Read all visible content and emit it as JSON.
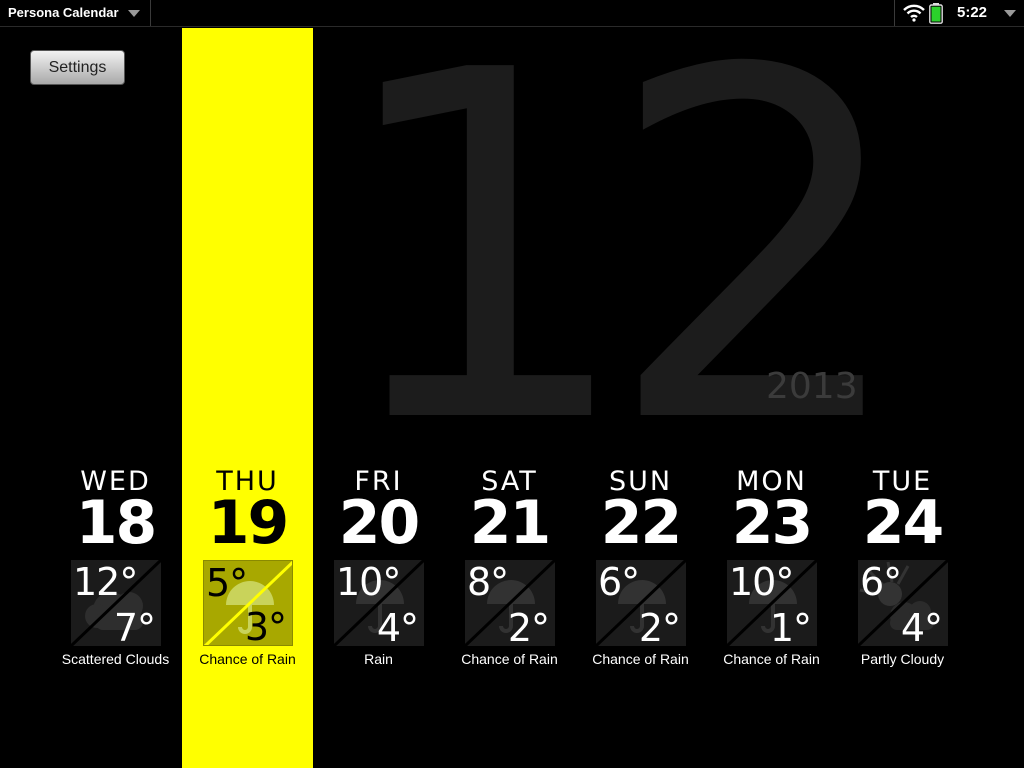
{
  "statusbar": {
    "app_title": "Persona Calendar",
    "time": "5:22",
    "battery_color": "#2bd12b"
  },
  "settings": {
    "label": "Settings"
  },
  "calendar": {
    "month": "12",
    "year": "2013",
    "highlight_color": "#ffff00"
  },
  "forecast": [
    {
      "dow": "WED",
      "day": "18",
      "high": "12°",
      "low": "7°",
      "condition": "Scattered Clouds",
      "icon": "cloud-icon",
      "selected": false
    },
    {
      "dow": "THU",
      "day": "19",
      "high": "5°",
      "low": "3°",
      "condition": "Chance of Rain",
      "icon": "umbrella-icon",
      "selected": true
    },
    {
      "dow": "FRI",
      "day": "20",
      "high": "10°",
      "low": "4°",
      "condition": "Rain",
      "icon": "umbrella-icon",
      "selected": false
    },
    {
      "dow": "SAT",
      "day": "21",
      "high": "8°",
      "low": "2°",
      "condition": "Chance of Rain",
      "icon": "umbrella-icon",
      "selected": false
    },
    {
      "dow": "SUN",
      "day": "22",
      "high": "6°",
      "low": "2°",
      "condition": "Chance of Rain",
      "icon": "umbrella-icon",
      "selected": false
    },
    {
      "dow": "MON",
      "day": "23",
      "high": "10°",
      "low": "1°",
      "condition": "Chance of Rain",
      "icon": "umbrella-icon",
      "selected": false
    },
    {
      "dow": "TUE",
      "day": "24",
      "high": "6°",
      "low": "4°",
      "condition": "Partly Cloudy",
      "icon": "partly-cloudy-icon",
      "selected": false
    }
  ]
}
